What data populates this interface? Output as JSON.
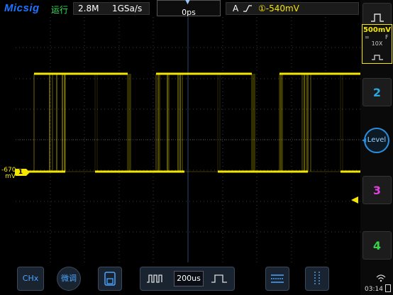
{
  "brand": "Micsig",
  "status": {
    "run": "运行"
  },
  "acquisition": {
    "memory_depth": "2.8M",
    "sample_rate": "1GSa/s"
  },
  "trigger": {
    "offset": "0ps",
    "source_type": "A",
    "level": "①-540mV",
    "edge_icon": "rising-edge-icon"
  },
  "ch1": {
    "offset_label": "-670",
    "offset_unit": "mV",
    "marker": "1",
    "scale": "500mV",
    "coupling": "=",
    "bandwidth": "F",
    "probe": "10X",
    "color": "#f5e600"
  },
  "side_buttons": {
    "ch2": "2",
    "ch3": "3",
    "ch4": "4",
    "level_knob": "Level",
    "ch2_color": "#29a8e0",
    "ch3_color": "#e040e0",
    "ch4_color": "#3ad24a"
  },
  "bottom": {
    "chx": "CHx",
    "manual": "微调",
    "timebase": "200us"
  },
  "status_bar": {
    "time": "03:14"
  }
}
